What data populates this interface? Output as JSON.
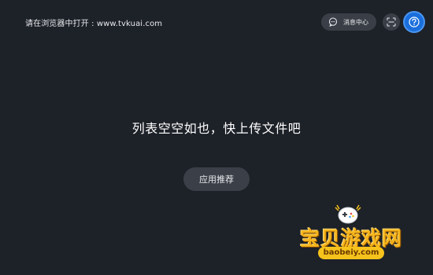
{
  "header": {
    "open_hint": "请在浏览器中打开 : www.tvkuai.com",
    "message_center_label": "消息中心"
  },
  "empty_state": {
    "message": "列表空空如也，快上传文件吧",
    "action_label": "应用推荐"
  },
  "watermark": {
    "title": "宝贝游戏网",
    "domain": "baobeiy.com"
  },
  "icons": {
    "message": "chat-bubble-icon",
    "scan": "scan-icon",
    "help": "question-circle-icon",
    "watermark_logo": "gamepad-icon"
  },
  "colors": {
    "background": "#1d2128",
    "button_bg": "#3a3f47",
    "help_accent": "#1a6fdc",
    "watermark_gold": "#f6b51c"
  }
}
